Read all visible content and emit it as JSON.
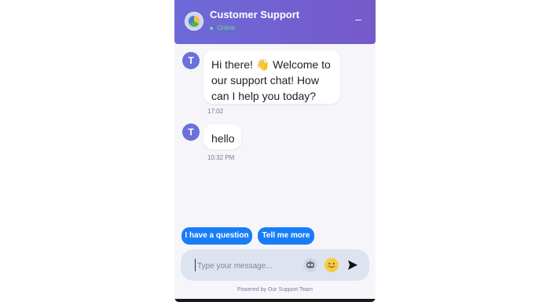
{
  "header": {
    "title": "Customer Support",
    "status": "Online",
    "minimize_label": "–"
  },
  "messages": [
    {
      "text": "Hi there! 👋 Welcome to our support chat! How can I help you today?",
      "time": "17:02",
      "avatar": "T"
    },
    {
      "text": "hello",
      "time": "10:32 PM",
      "avatar": "T"
    }
  ],
  "quick_replies": [
    {
      "label": "I have a question"
    },
    {
      "label": "Tell me more"
    }
  ],
  "composer": {
    "placeholder": "Type your message...",
    "bot_icon": "bot-icon",
    "emoji_icon": "emoji-icon",
    "send_icon": "send-icon"
  },
  "footer": {
    "powered_by": "Powered by Our Support Team"
  },
  "colors": {
    "header_start": "#6d6ad9",
    "header_end": "#7659c9",
    "accent": "#187ef7",
    "avatar": "#6c70d9",
    "status": "#62e28b"
  }
}
